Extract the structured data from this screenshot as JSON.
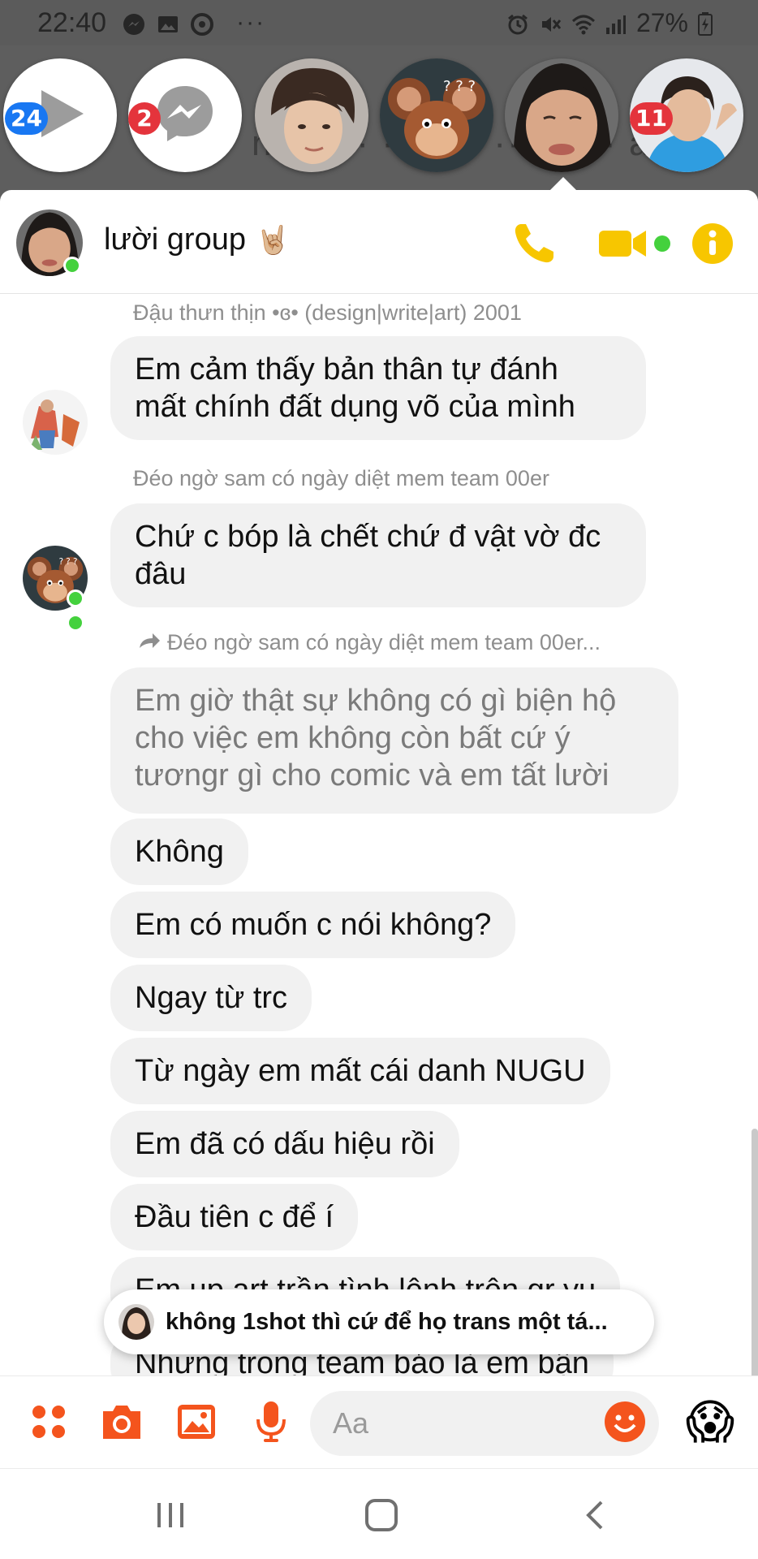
{
  "status_bar": {
    "time": "22:40",
    "more": "···",
    "battery": "27%",
    "left_icons": [
      "messenger-icon",
      "gallery-icon",
      "chrome-icon"
    ],
    "right_icons": [
      "alarm-icon",
      "mute-icon",
      "wifi-icon",
      "signal-icon",
      "battery-icon"
    ]
  },
  "chat_heads": [
    {
      "name": "video",
      "badge": "24",
      "badge_color": "#1877f2"
    },
    {
      "name": "messenger",
      "badge": "2",
      "badge_color": "#e4343c"
    },
    {
      "name": "person-1",
      "badge": ""
    },
    {
      "name": "jerry",
      "badge": ""
    },
    {
      "name": "person-2-active",
      "badge": ""
    },
    {
      "name": "person-3",
      "badge": "11",
      "badge_color": "#e4343c"
    }
  ],
  "chat_header": {
    "title": "lười group",
    "emoji": "🤘🏼",
    "accent_color": "#f7c600",
    "actions": [
      "phone-icon",
      "video-call-icon",
      "info-icon"
    ]
  },
  "messages": [
    {
      "sender": "Đậu thưn thịn •ɞ•  (design|write|art) 2001",
      "text_lines": [
        "Em cảm thấy bản thân tự đánh",
        "mất chính đất dụng võ của mình"
      ]
    },
    {
      "sender": "Đéo ngờ sam có ngày diệt mem team 00er",
      "text_lines": [
        "Chứ c bóp là chết chứ đ vật vờ đc",
        "đâu"
      ]
    },
    {
      "forwarded_label": "Đéo ngờ sam có ngày diệt mem team 00er...",
      "text_lines": [
        "Em giờ thật sự không có gì biện hộ",
        "cho việc em không còn bất cứ ý",
        "tươngr gì cho comic và em tất lười"
      ]
    },
    {
      "text": "Không"
    },
    {
      "text": "Em có muốn c nói không?"
    },
    {
      "text": "Ngay từ trc"
    },
    {
      "text": "Từ ngày em mất cái danh NUGU"
    },
    {
      "text": "Em đã có dấu hiệu rồi"
    },
    {
      "text": "Đầu tiên c để í"
    },
    {
      "text": "Em up art trần tình lệnh trên gr yu"
    },
    {
      "text": "Nhưng trong team bảo là em bận"
    }
  ],
  "toast": {
    "text": "không 1shot thì cứ để họ trans một tá..."
  },
  "composer": {
    "placeholder": "Aa",
    "accent_color": "#f4541d",
    "buttons": [
      "apps-icon",
      "camera-icon",
      "gallery-icon",
      "microphone-icon",
      "emoji-icon",
      "scream-emoji-icon"
    ],
    "reaction": "😱"
  },
  "navbar": {
    "buttons": [
      "recents-icon",
      "home-icon",
      "back-icon"
    ]
  }
}
